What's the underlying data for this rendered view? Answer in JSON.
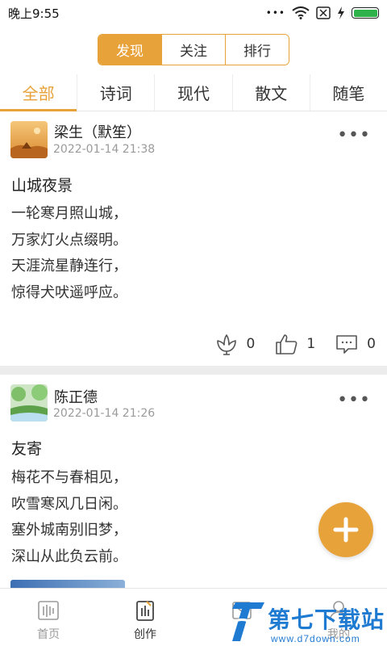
{
  "status_bar": {
    "time": "晚上9:55",
    "dots": "•••"
  },
  "segment_tabs": [
    {
      "label": "发现",
      "active": true
    },
    {
      "label": "关注",
      "active": false
    },
    {
      "label": "排行",
      "active": false
    }
  ],
  "categories": [
    {
      "label": "全部",
      "active": true
    },
    {
      "label": "诗词",
      "active": false
    },
    {
      "label": "现代",
      "active": false
    },
    {
      "label": "散文",
      "active": false
    },
    {
      "label": "随笔",
      "active": false
    }
  ],
  "posts": [
    {
      "author": "梁生（默笙）",
      "time": "2022-01-14 21:38",
      "title": "山城夜景",
      "lines": [
        "一轮寒月照山城，",
        "万家灯火点缀明。",
        "天涯流星静连行，",
        "惊得犬吠遥呼应。"
      ],
      "flowers": "0",
      "likes": "1",
      "comments": "0",
      "more": "•••"
    },
    {
      "author": "陈正德",
      "time": "2022-01-14 21:26",
      "title": "友寄",
      "lines": [
        "梅花不与春相见，",
        "吹雪寒风几日闲。",
        "塞外城南别旧梦，",
        "深山从此负云前。"
      ],
      "more": "•••"
    }
  ],
  "bottom_nav": [
    {
      "label": "首页",
      "icon": "home-icon",
      "active": false
    },
    {
      "label": "创作",
      "icon": "create-icon",
      "active": true
    },
    {
      "label": "",
      "icon": "message-icon",
      "active": false
    },
    {
      "label": "我的",
      "icon": "profile-icon",
      "active": false
    }
  ],
  "watermark": {
    "text": "第七下载站",
    "url": "www.d7down.com"
  },
  "colors": {
    "accent": "#e8a23a",
    "watermark": "#1f7ad1"
  }
}
